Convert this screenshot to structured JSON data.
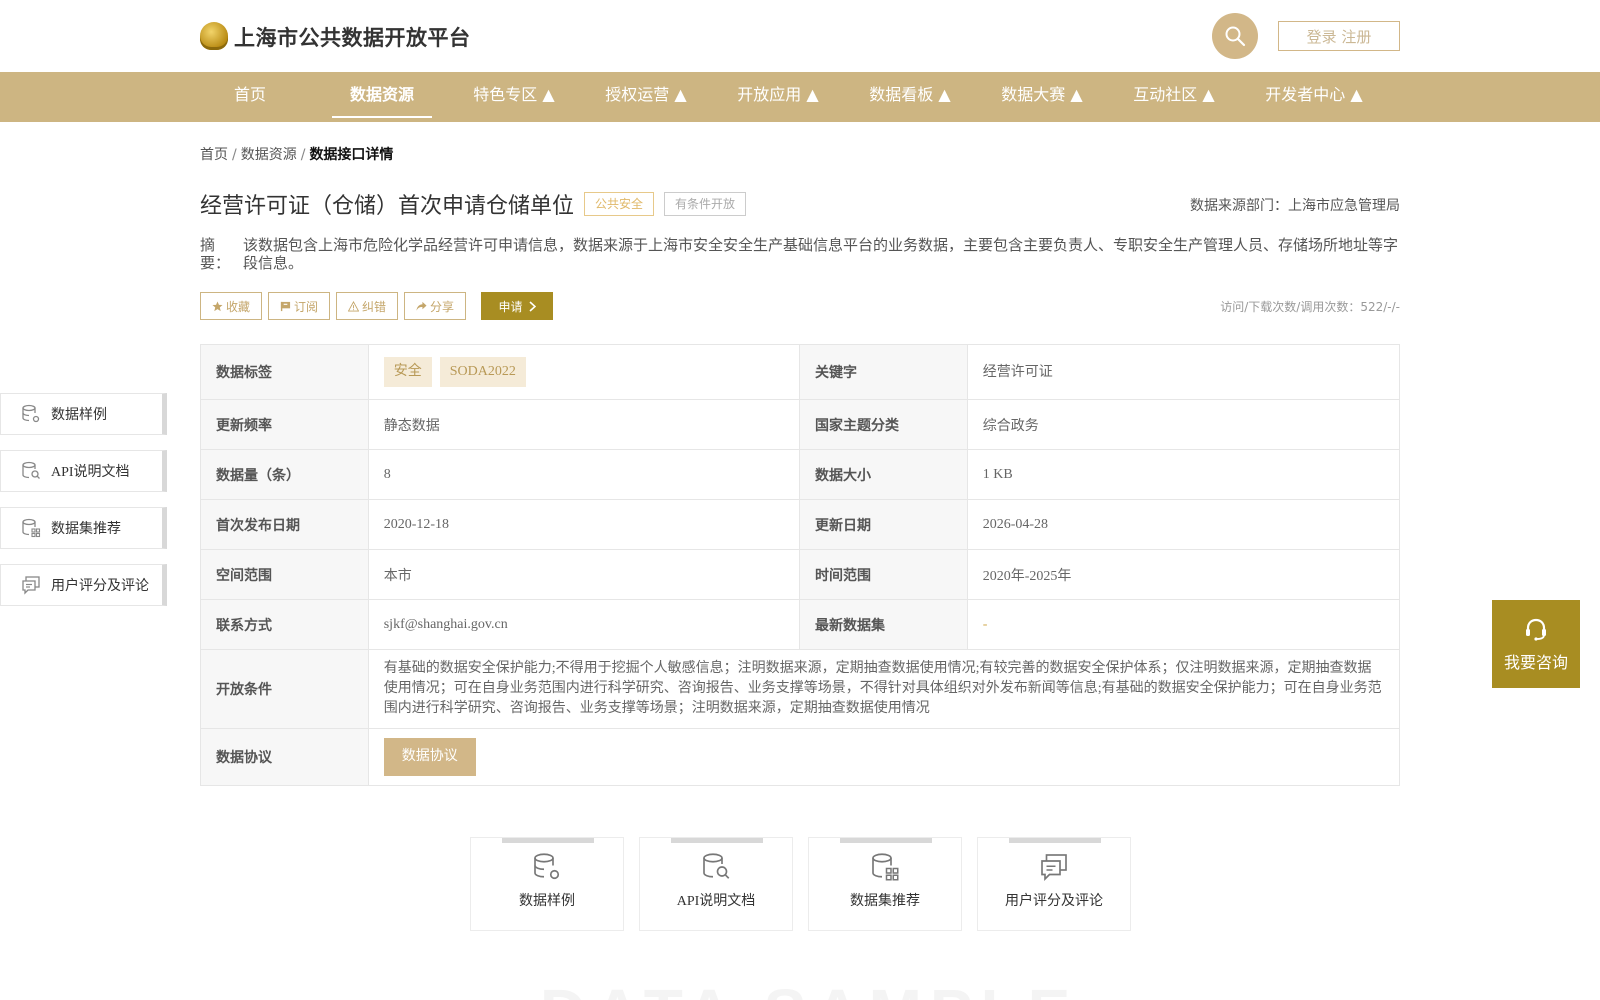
{
  "header": {
    "site_title": "上海市公共数据开放平台",
    "login_label": "登录 注册"
  },
  "nav": {
    "items": [
      {
        "label": "首页"
      },
      {
        "label": "数据资源"
      },
      {
        "label": "特色专区 ▲"
      },
      {
        "label": "授权运营 ▲"
      },
      {
        "label": "开放应用 ▲"
      },
      {
        "label": "数据看板 ▲"
      },
      {
        "label": "数据大赛 ▲"
      },
      {
        "label": "互动社区 ▲"
      },
      {
        "label": "开发者中心 ▲"
      }
    ],
    "active_index": 1
  },
  "breadcrumb": {
    "items": [
      "首页",
      "数据资源"
    ],
    "separator": "/",
    "current": "数据接口详情"
  },
  "dataset": {
    "title": "经营许可证（仓储）首次申请仓储单位",
    "tag_public": "公共安全",
    "tag_conditional": "有条件开放",
    "source_dept": "数据来源部门：上海市应急管理局",
    "summary_label": "摘　要：",
    "summary": "该数据包含上海市危险化学品经营许可申请信息，数据来源于上海市安全安全生产基础信息平台的业务数据，主要包含主要负责人、专职安全生产管理人员、存储场所地址等字段信息。"
  },
  "actions": {
    "collect": "收藏",
    "subscribe": "订阅",
    "correct": "纠错",
    "share": "分享",
    "apply": "申请",
    "visits": "访问/下载次数/调用次数：522/-/-"
  },
  "table": {
    "tags_label": "数据标签",
    "tags": [
      "安全",
      "SODA2022"
    ],
    "keyword_label": "关键字",
    "keyword": "经营许可证",
    "freq_label": "更新频率",
    "freq": "静态数据",
    "theme_label": "国家主题分类",
    "theme": "综合政务",
    "count_label": "数据量（条）",
    "count": "8",
    "size_label": "数据大小",
    "size": "1 KB",
    "first_pub_label": "首次发布日期",
    "first_pub": "2020-12-18",
    "update_label": "更新日期",
    "update": "2026-04-28",
    "space_label": "空间范围",
    "space": "本市",
    "time_label": "时间范围",
    "time": "2020年-2025年",
    "contact_label": "联系方式",
    "contact": "sjkf@shanghai.gov.cn",
    "latest_label": "最新数据集",
    "latest": "-",
    "conditions_label": "开放条件",
    "conditions": "有基础的数据安全保护能力;不得用于挖掘个人敏感信息；注明数据来源，定期抽查数据使用情况;有较完善的数据安全保护体系；仅注明数据来源，定期抽查数据使用情况；可在自身业务范围内进行科学研究、咨询报告、业务支撑等场景，不得针对具体组织对外发布新闻等信息;有基础的数据安全保护能力；可在自身业务范围内进行科学研究、咨询报告、业务支撑等场景；注明数据来源，定期抽查数据使用情况",
    "protocol_label": "数据协议",
    "protocol_button": "数据协议"
  },
  "side_nav": {
    "items": [
      {
        "label": "数据样例",
        "icon": "database-settings-icon"
      },
      {
        "label": "API说明文档",
        "icon": "database-search-icon"
      },
      {
        "label": "数据集推荐",
        "icon": "database-grid-icon"
      },
      {
        "label": "用户评分及评论",
        "icon": "comment-icon"
      }
    ]
  },
  "consult": {
    "label": "我要咨询",
    "icon": "headset-icon"
  },
  "cards": {
    "items": [
      {
        "label": "数据样例",
        "icon": "database-settings-icon"
      },
      {
        "label": "API说明文档",
        "icon": "database-search-icon"
      },
      {
        "label": "数据集推荐",
        "icon": "database-grid-icon"
      },
      {
        "label": "用户评分及评论",
        "icon": "comment-icon"
      }
    ]
  },
  "watermark": "DATA SAMPLE",
  "colors": {
    "accent": "#cdb582",
    "accent_dark": "#a88d22",
    "tag_bg": "#f5ebd8"
  }
}
